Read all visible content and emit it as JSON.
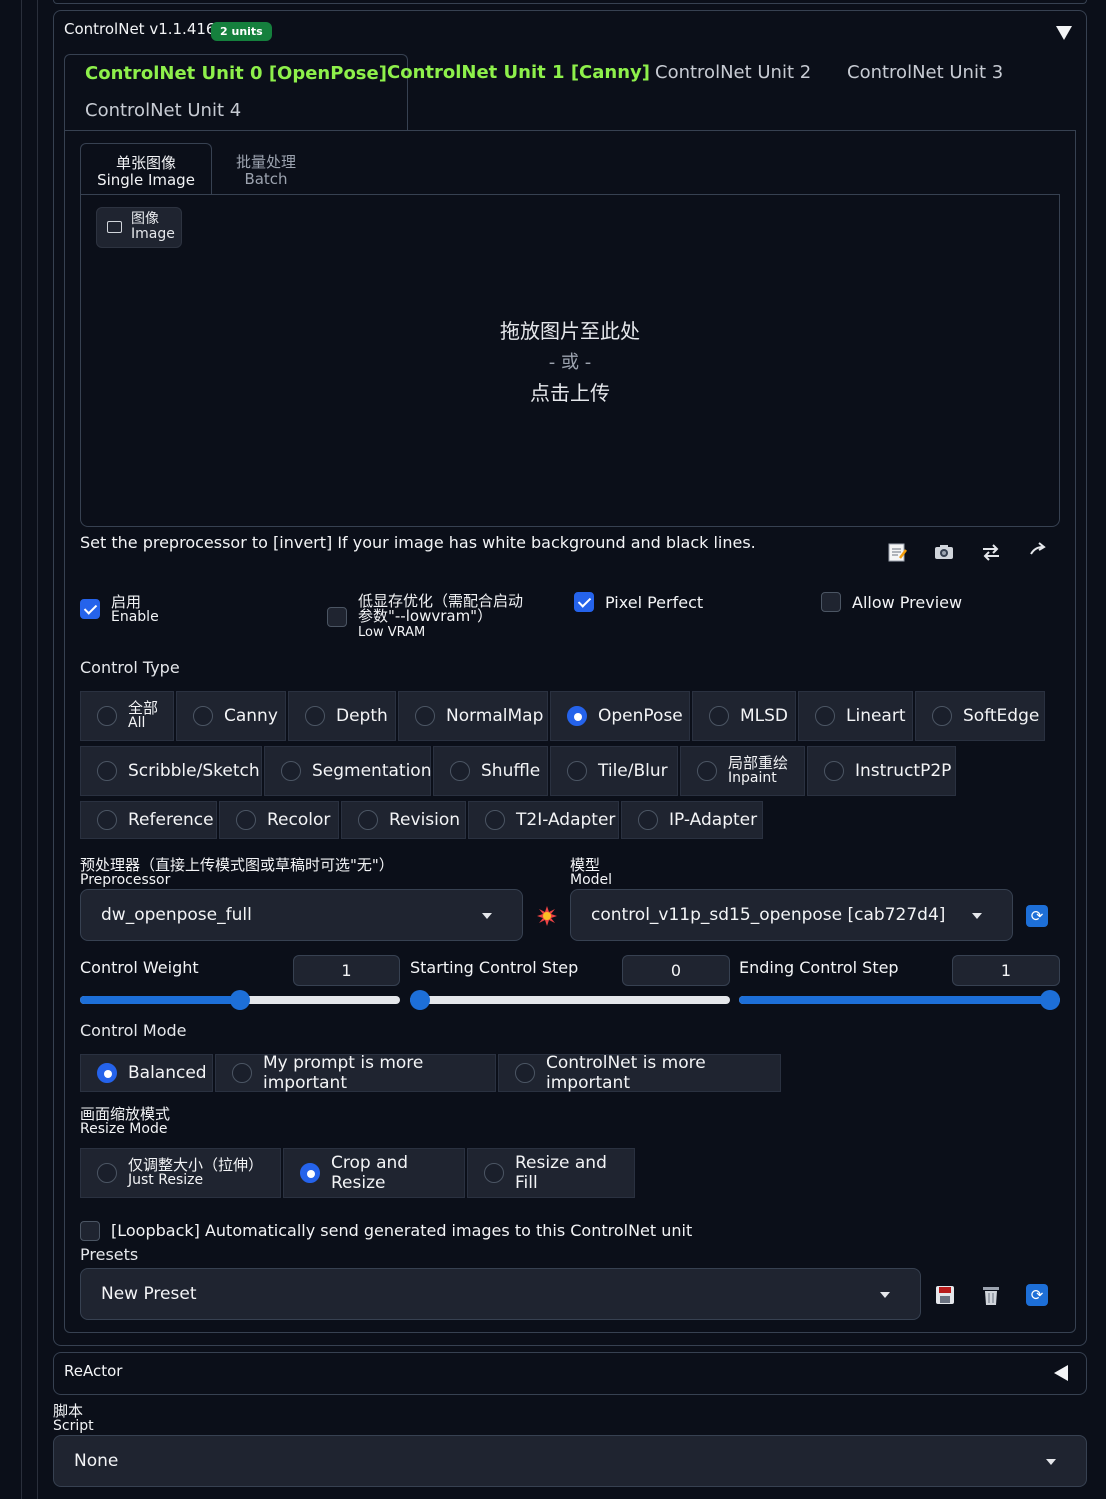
{
  "controlnet": {
    "title": "ControlNet v1.1.416",
    "badge": "2 units",
    "collapse_icon": "triangle-down-icon",
    "unit_tabs": [
      "ControlNet Unit 0 [OpenPose]",
      "ControlNet Unit 1 [Canny]",
      "ControlNet Unit 2",
      "ControlNet Unit 3",
      "ControlNet Unit 4"
    ],
    "image_tabs": {
      "single_cn": "单张图像",
      "single_en": "Single Image",
      "batch_cn": "批量处理",
      "batch_en": "Batch"
    },
    "image_label_cn": "图像",
    "image_label_en": "Image",
    "drop_line1": "拖放图片至此处",
    "drop_line2": "- 或 -",
    "drop_line3": "点击上传",
    "hint": "Set the preprocessor to [invert] If your image has white background and black lines.",
    "tool_icons": [
      "edit-icon",
      "camera-icon",
      "swap-icon",
      "send-dimensions-icon"
    ],
    "enable_cn": "启用",
    "enable_en": "Enable",
    "enable_checked": true,
    "lowvram_cn1": "低显存优化（需配合启动",
    "lowvram_cn2": "参数\"--lowvram\"）",
    "lowvram_en": "Low VRAM",
    "lowvram_checked": false,
    "pixel_perfect": "Pixel Perfect",
    "pixel_perfect_checked": true,
    "allow_preview": "Allow Preview",
    "allow_preview_checked": false,
    "control_type_label": "Control Type",
    "control_types": {
      "all_cn": "全部",
      "all_en": "All",
      "canny": "Canny",
      "depth": "Depth",
      "normalmap": "NormalMap",
      "openpose": "OpenPose",
      "mlsd": "MLSD",
      "lineart": "Lineart",
      "softedge": "SoftEdge",
      "scribble": "Scribble/Sketch",
      "segmentation": "Segmentation",
      "shuffle": "Shuffle",
      "tileblur": "Tile/Blur",
      "inpaint_cn": "局部重绘",
      "inpaint_en": "Inpaint",
      "instructp2p": "InstructP2P",
      "reference": "Reference",
      "recolor": "Recolor",
      "revision": "Revision",
      "t2i": "T2I-Adapter",
      "ipadapter": "IP-Adapter",
      "selected": "OpenPose"
    },
    "preprocessor_cn": "预处理器（直接上传模式图或草稿时可选\"无\"）",
    "preprocessor_en": "Preprocessor",
    "preprocessor_value": "dw_openpose_full",
    "model_cn": "模型",
    "model_en": "Model",
    "model_value": "control_v11p_sd15_openpose [cab727d4]",
    "control_weight_label": "Control Weight",
    "control_weight": "1",
    "starting_step_label": "Starting Control Step",
    "starting_step": "0",
    "ending_step_label": "Ending Control Step",
    "ending_step": "1",
    "slider_fractions": {
      "weight": 0.5,
      "start": 0.0,
      "end": 1.0
    },
    "control_mode_label": "Control Mode",
    "control_modes": [
      "Balanced",
      "My prompt is more important",
      "ControlNet is more important"
    ],
    "control_mode_selected": "Balanced",
    "resize_cn": "画面缩放模式",
    "resize_en": "Resize Mode",
    "resize_just_cn": "仅调整大小（拉伸）",
    "resize_just_en": "Just Resize",
    "resize_crop": "Crop and Resize",
    "resize_fill": "Resize and Fill",
    "resize_selected": "Crop and Resize",
    "loopback": "[Loopback] Automatically send generated images to this ControlNet unit",
    "loopback_checked": false,
    "presets_label": "Presets",
    "presets_value": "New Preset",
    "preset_icons": [
      "save-icon",
      "delete-icon",
      "refresh-icon"
    ]
  },
  "reactor": {
    "title": "ReActor",
    "expand_icon": "triangle-left-icon"
  },
  "script": {
    "label_cn": "脚本",
    "label_en": "Script",
    "value": "None"
  },
  "colors": {
    "accent": "#1d6fd8",
    "tab_green": "#8ef04b",
    "badge_green": "#15803d",
    "bg": "#0b0f19"
  }
}
